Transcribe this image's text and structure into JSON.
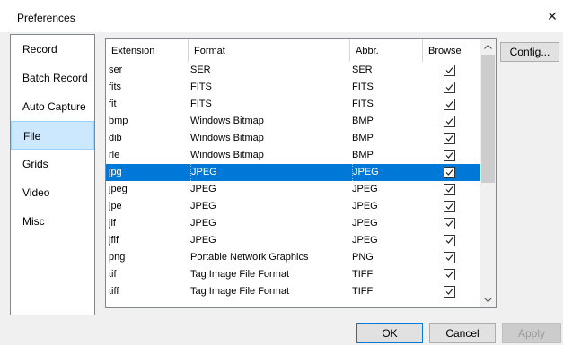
{
  "window": {
    "title": "Preferences",
    "close_glyph": "✕"
  },
  "nav": {
    "items": [
      {
        "label": "Record",
        "selected": false
      },
      {
        "label": "Batch Record",
        "selected": false
      },
      {
        "label": "Auto Capture",
        "selected": false
      },
      {
        "label": "File",
        "selected": true
      },
      {
        "label": "Grids",
        "selected": false
      },
      {
        "label": "Video",
        "selected": false
      },
      {
        "label": "Misc",
        "selected": false
      }
    ]
  },
  "table": {
    "columns": [
      "Extension",
      "Format",
      "Abbr.",
      "Browse"
    ],
    "rows": [
      {
        "ext": "ser",
        "format": "SER",
        "abbr": "SER",
        "browse": true,
        "selected": false
      },
      {
        "ext": "fits",
        "format": "FITS",
        "abbr": "FITS",
        "browse": true,
        "selected": false
      },
      {
        "ext": "fit",
        "format": "FITS",
        "abbr": "FITS",
        "browse": true,
        "selected": false
      },
      {
        "ext": "bmp",
        "format": "Windows Bitmap",
        "abbr": "BMP",
        "browse": true,
        "selected": false
      },
      {
        "ext": "dib",
        "format": "Windows Bitmap",
        "abbr": "BMP",
        "browse": true,
        "selected": false
      },
      {
        "ext": "rle",
        "format": "Windows Bitmap",
        "abbr": "BMP",
        "browse": true,
        "selected": false
      },
      {
        "ext": "jpg",
        "format": "JPEG",
        "abbr": "JPEG",
        "browse": true,
        "selected": true
      },
      {
        "ext": "jpeg",
        "format": "JPEG",
        "abbr": "JPEG",
        "browse": true,
        "selected": false
      },
      {
        "ext": "jpe",
        "format": "JPEG",
        "abbr": "JPEG",
        "browse": true,
        "selected": false
      },
      {
        "ext": "jif",
        "format": "JPEG",
        "abbr": "JPEG",
        "browse": true,
        "selected": false
      },
      {
        "ext": "jfif",
        "format": "JPEG",
        "abbr": "JPEG",
        "browse": true,
        "selected": false
      },
      {
        "ext": "png",
        "format": "Portable Network Graphics",
        "abbr": "PNG",
        "browse": true,
        "selected": false
      },
      {
        "ext": "tif",
        "format": "Tag Image File Format",
        "abbr": "TIFF",
        "browse": true,
        "selected": false
      },
      {
        "ext": "tiff",
        "format": "Tag Image File Format",
        "abbr": "TIFF",
        "browse": true,
        "selected": false
      }
    ]
  },
  "buttons": {
    "config": "Config...",
    "ok": "OK",
    "cancel": "Cancel",
    "apply": "Apply"
  },
  "icons": {
    "close": "close-icon",
    "check": "checkmark-icon",
    "scroll_up": "chevron-up-icon",
    "scroll_down": "chevron-down-icon"
  },
  "colors": {
    "selection": "#0078d7",
    "nav_selected": "#cce8ff"
  }
}
